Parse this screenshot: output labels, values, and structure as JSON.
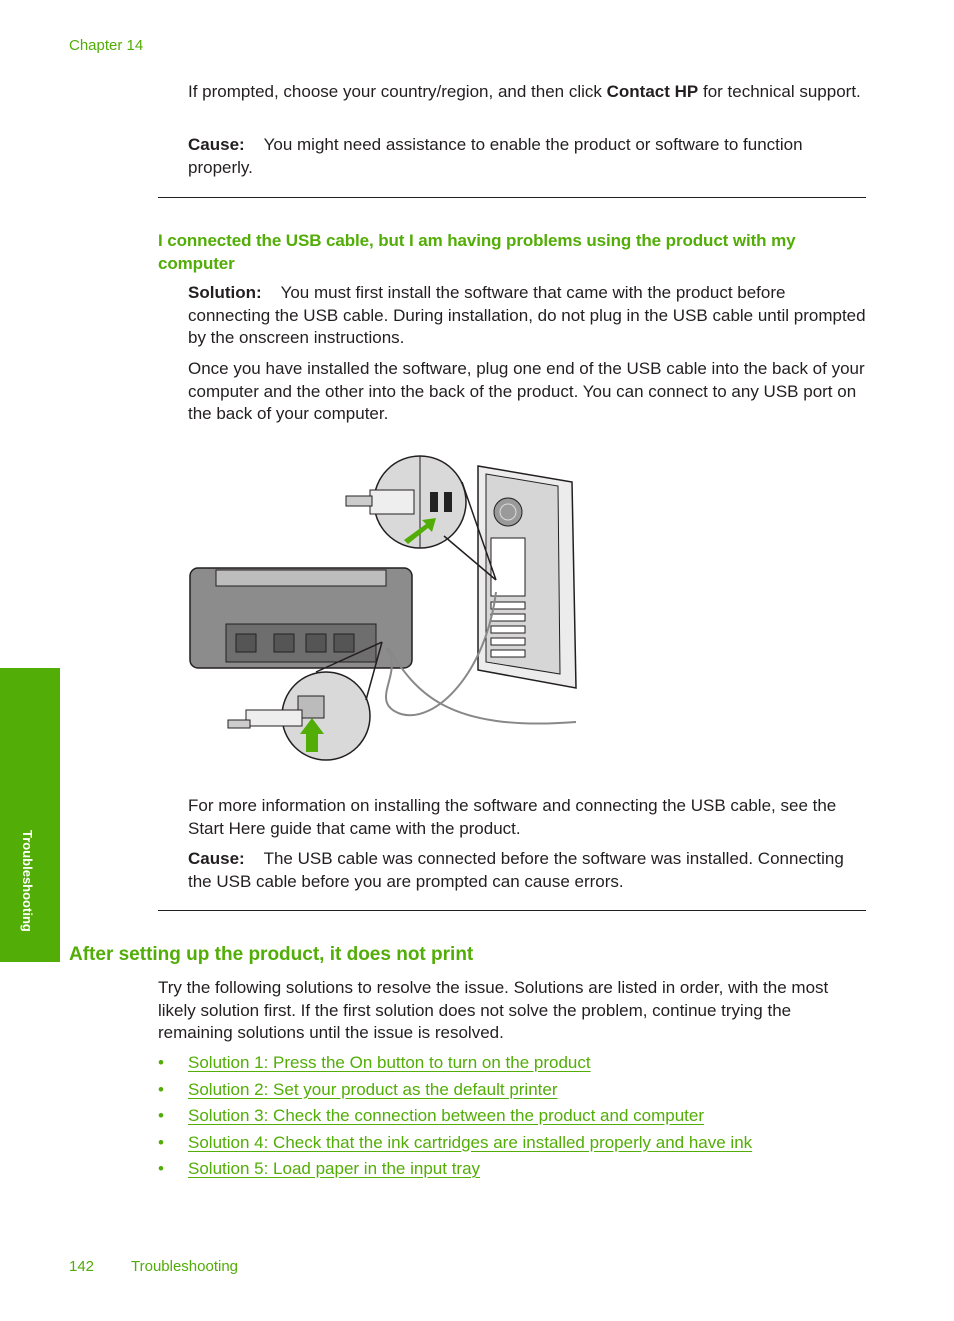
{
  "header": {
    "chapter": "Chapter 14"
  },
  "intro": {
    "prompt_before": "If prompted, choose your country/region, and then click ",
    "prompt_bold": "Contact HP",
    "prompt_after": " for technical support.",
    "cause_label": "Cause:",
    "cause_text": "You might need assistance to enable the product or software to function properly."
  },
  "usb_section": {
    "heading": "I connected the USB cable, but I am having problems using the product with my computer",
    "solution_label": "Solution:",
    "solution_text": "You must first install the software that came with the product before connecting the USB cable. During installation, do not plug in the USB cable until prompted by the onscreen instructions.",
    "para2": "Once you have installed the software, plug one end of the USB cable into the back of your computer and the other into the back of the product. You can connect to any USB port on the back of your computer.",
    "figure_alt": "Illustration: USB cable connecting the back of the product to a USB port on the back of the computer",
    "more_info": "For more information on installing the software and connecting the USB cable, see the Start Here guide that came with the product.",
    "cause_label": "Cause:",
    "cause_text": "The USB cable was connected before the software was installed. Connecting the USB cable before you are prompted can cause errors."
  },
  "print_section": {
    "heading": "After setting up the product, it does not print",
    "intro": "Try the following solutions to resolve the issue. Solutions are listed in order, with the most likely solution first. If the first solution does not solve the problem, continue trying the remaining solutions until the issue is resolved.",
    "bullet": "•",
    "links": [
      "Solution 1: Press the On button to turn on the product",
      "Solution 2: Set your product as the default printer",
      "Solution 3: Check the connection between the product and computer",
      "Solution 4: Check that the ink cartridges are installed properly and have ink",
      "Solution 5: Load paper in the input tray"
    ]
  },
  "side_tab": {
    "label": "Troubleshooting"
  },
  "footer": {
    "page_number": "142",
    "section": "Troubleshooting"
  },
  "colors": {
    "accent": "#52ad07",
    "text": "#231f20"
  }
}
